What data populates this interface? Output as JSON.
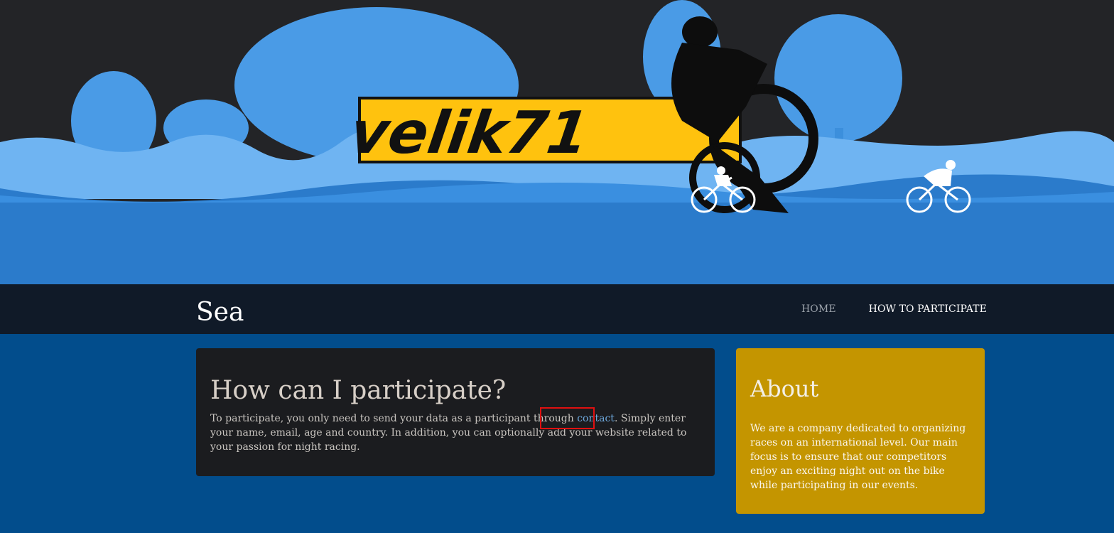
{
  "hero": {
    "logo_text": "velik71",
    "colors": {
      "sky": "#232427",
      "tree_light": "#6fb4f2",
      "tree_mid": "#3a8fe0",
      "ground": "#2b7bcb",
      "logo_yellow": "#ffc20e"
    }
  },
  "navbar": {
    "brand": "Sea",
    "links": [
      {
        "label": "HOME",
        "active": true
      },
      {
        "label": "HOW TO PARTICIPATE",
        "active": false
      }
    ]
  },
  "main": {
    "title": "How can I participate?",
    "text_before": "To participate, you only need to send your data as a participant through ",
    "link_label": "contact",
    "text_after": ". Simply enter your name, email, age and country. In addition, you can optionally add your website related to your passion for night racing."
  },
  "sidebar": {
    "title": "About",
    "text": "We are a company dedicated to organizing races on an international level. Our main focus is to ensure that our competitors enjoy an exciting night out on the bike while participating in our events."
  }
}
